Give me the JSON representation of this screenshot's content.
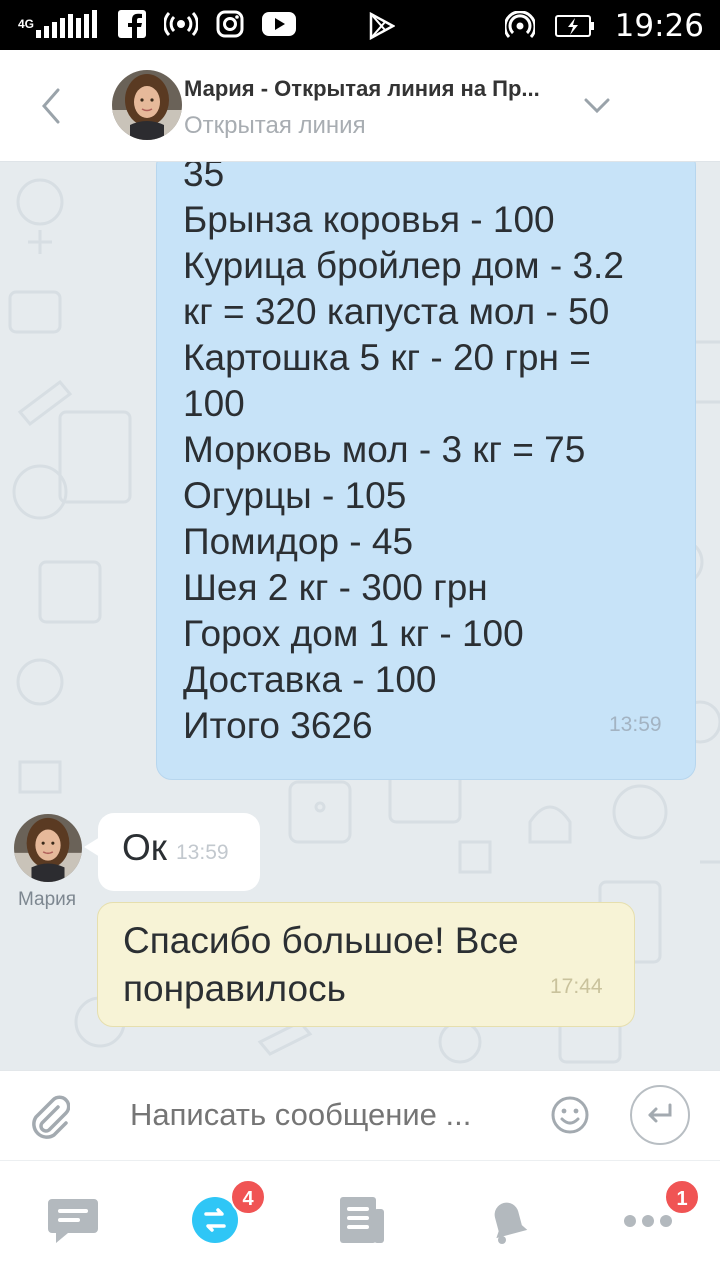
{
  "statusbar": {
    "network": "4G",
    "time": "19:26"
  },
  "header": {
    "title": "Мария - Открытая линия на Пр...",
    "subtitle": "Открытая линия"
  },
  "messages": {
    "main": {
      "lines": [
        "35",
        "Брынза коровья - 100",
        "Курица бройлер дом - 3.2",
        "кг = 320 капуста мол - 50",
        "Картошка 5 кг - 20 грн =",
        "100",
        "Морковь мол - 3 кг = 75",
        "Огурцы - 105",
        "Помидор - 45",
        "Шея  2 кг - 300 грн",
        "Горох дом  1 кг - 100",
        "Доставка - 100",
        "Итого 3626"
      ],
      "time": "13:59"
    },
    "ok": {
      "text": "Ок",
      "time": "13:59",
      "sender": "Мария"
    },
    "thanks": {
      "text": "Спасибо большое!  Все понравилось",
      "time": "17:44"
    }
  },
  "input": {
    "placeholder": "Написать сообщение ..."
  },
  "nav": {
    "items": [
      {
        "name": "chats-icon"
      },
      {
        "name": "open-lines-icon",
        "badge": "4"
      },
      {
        "name": "feed-icon"
      },
      {
        "name": "notifications-icon"
      },
      {
        "name": "more-icon",
        "badge": "1"
      }
    ]
  },
  "colors": {
    "accent": "#2fc6f6",
    "bubble_out": "#c7e3f8",
    "bubble_highlight": "#f7f3d6",
    "badge": "#f05454"
  }
}
